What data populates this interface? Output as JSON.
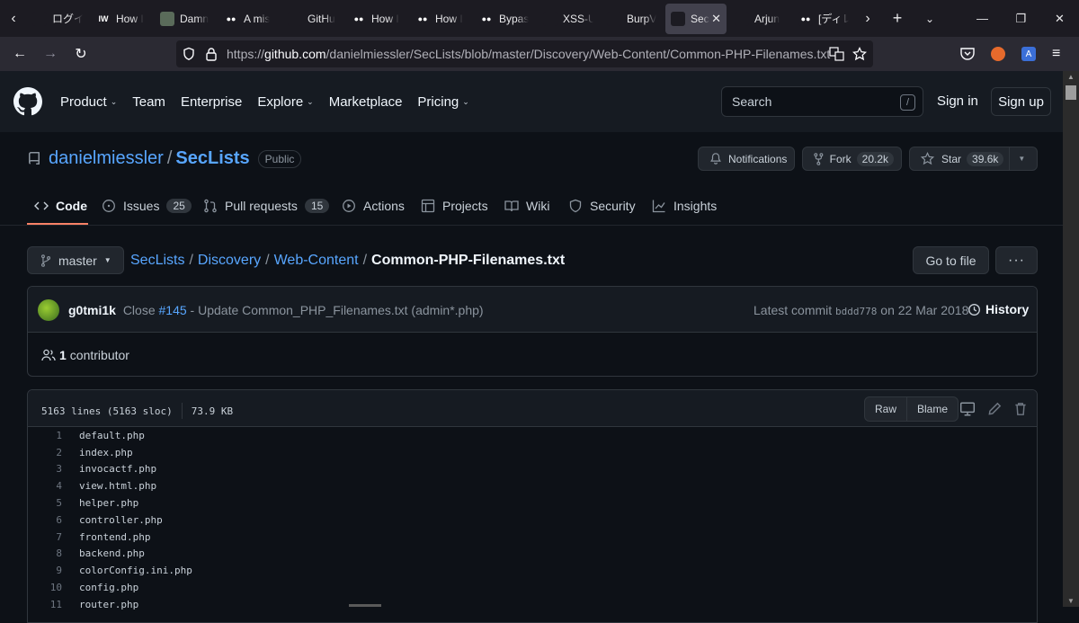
{
  "browser": {
    "tabs": [
      {
        "title": "ログイン",
        "fav_color": "#1c1b22",
        "fav_text": ""
      },
      {
        "title": "How I",
        "fav_color": "#1c1b22",
        "fav_text": "IW"
      },
      {
        "title": "Damn",
        "fav_color": "#5a6b5a",
        "fav_text": ""
      },
      {
        "title": "A mis",
        "fav_color": "#1c1b22",
        "fav_text": "●●"
      },
      {
        "title": "GitHu",
        "fav_color": "#1c1b22",
        "fav_text": ""
      },
      {
        "title": "How I",
        "fav_color": "#1c1b22",
        "fav_text": "●●"
      },
      {
        "title": "How I",
        "fav_color": "#1c1b22",
        "fav_text": "●●"
      },
      {
        "title": "Bypas",
        "fav_color": "#1c1b22",
        "fav_text": "●●"
      },
      {
        "title": "XSS-U",
        "fav_color": "#1c1b22",
        "fav_text": ""
      },
      {
        "title": "BurpV",
        "fav_color": "#1c1b22",
        "fav_text": ""
      },
      {
        "title": "Sec",
        "fav_color": "#1c1b22",
        "fav_text": ""
      },
      {
        "title": "Arjun",
        "fav_color": "#1c1b22",
        "fav_text": ""
      },
      {
        "title": "[ディレ",
        "fav_color": "#1c1b22",
        "fav_text": "●●"
      }
    ],
    "url_scheme": "https://",
    "url_host": "github.com",
    "url_path": "/danielmiessler/SecLists/blob/master/Discovery/Web-Content/Common-PHP-Filenames.txt"
  },
  "gh": {
    "nav": [
      {
        "label": "Product",
        "chev": true
      },
      {
        "label": "Team",
        "chev": false
      },
      {
        "label": "Enterprise",
        "chev": false
      },
      {
        "label": "Explore",
        "chev": true
      },
      {
        "label": "Marketplace",
        "chev": false
      },
      {
        "label": "Pricing",
        "chev": true
      }
    ],
    "search_placeholder": "Search",
    "search_key": "/",
    "signin": "Sign in",
    "signup": "Sign up"
  },
  "repo": {
    "owner": "danielmiessler",
    "name": "SecLists",
    "visibility": "Public",
    "notifications_label": "Notifications",
    "fork_label": "Fork",
    "fork_count": "20.2k",
    "star_label": "Star",
    "star_count": "39.6k",
    "tabs": [
      {
        "label": "Code",
        "count": ""
      },
      {
        "label": "Issues",
        "count": "25"
      },
      {
        "label": "Pull requests",
        "count": "15"
      },
      {
        "label": "Actions",
        "count": ""
      },
      {
        "label": "Projects",
        "count": ""
      },
      {
        "label": "Wiki",
        "count": ""
      },
      {
        "label": "Security",
        "count": ""
      },
      {
        "label": "Insights",
        "count": ""
      }
    ]
  },
  "path": {
    "branch": "master",
    "crumbs": [
      "SecLists",
      "Discovery",
      "Web-Content"
    ],
    "file": "Common-PHP-Filenames.txt",
    "goto_label": "Go to file",
    "more_label": "···"
  },
  "commit": {
    "author": "g0tmi1k",
    "msg_pre": "Close",
    "pr": "#145",
    "msg_post": "- Update Common_PHP_Filenames.txt (admin*.php)",
    "latest_label": "Latest commit",
    "sha": "bddd778",
    "date_text": "on 22 Mar 2018",
    "history_label": "History",
    "contributors_count": "1",
    "contributors_label": "contributor"
  },
  "file": {
    "lines_info": "5163 lines (5163 sloc)",
    "size": "73.9 KB",
    "raw_label": "Raw",
    "blame_label": "Blame",
    "lines": [
      {
        "n": "1",
        "t": "default.php"
      },
      {
        "n": "2",
        "t": "index.php"
      },
      {
        "n": "3",
        "t": "invocactf.php"
      },
      {
        "n": "4",
        "t": "view.html.php"
      },
      {
        "n": "5",
        "t": "helper.php"
      },
      {
        "n": "6",
        "t": "controller.php"
      },
      {
        "n": "7",
        "t": "frontend.php"
      },
      {
        "n": "8",
        "t": "backend.php"
      },
      {
        "n": "9",
        "t": "colorConfig.ini.php"
      },
      {
        "n": "10",
        "t": "config.php"
      },
      {
        "n": "11",
        "t": "router.php"
      }
    ]
  },
  "colors": {
    "accent_link": "#58a6ff",
    "tab_underline": "#f78166",
    "bg": "#0d1117",
    "header_bg": "#161b22"
  }
}
